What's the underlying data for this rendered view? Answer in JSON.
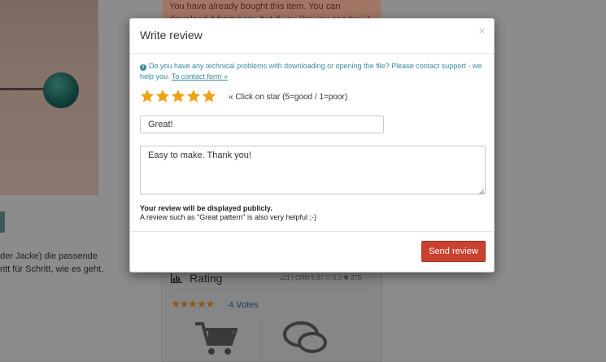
{
  "background": {
    "banner_text_line1": "You have already bought this item. You can",
    "banner_text_line2_a": "download it from ",
    "banner_text_line2_link": "here",
    "banner_text_line2_b": ", but if you like you can buy it",
    "desc_line1": "der Jacke) die passende",
    "desc_line2": "ritt für Schritt, wie es geht.",
    "rating_title": "Rating",
    "rating_stats": "⤓21 | CRN 5.87  ⚇ 5.0  ◉ 375",
    "stars": "★★★★★",
    "votes": "4 Votes"
  },
  "modal": {
    "title": "Write review",
    "close": "×",
    "info_text": "Do you have any technical problems with downloading or opening the file? Please contact support - we help you.",
    "info_link": "To contact form »",
    "star_count": 5,
    "star_color": "#f0a114",
    "star_hint": "« Click on star (5=good / 1=poor)",
    "title_value": "Great!",
    "review_value": "Easy to make. Thank you!",
    "public_note_bold": "Your review will be displayed publicly.",
    "public_note": "A review such as \"Great pattern\" is also very helpful ;-)",
    "send_label": "Send review"
  }
}
